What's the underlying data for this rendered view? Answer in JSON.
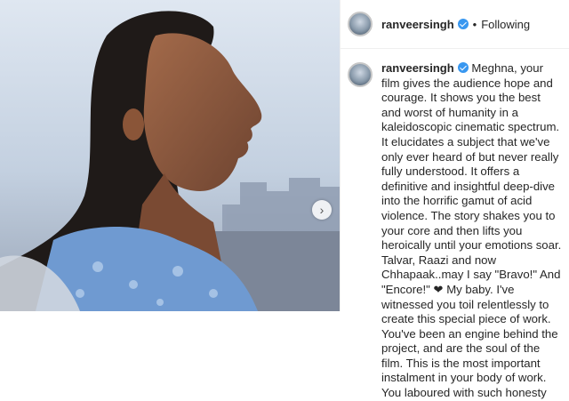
{
  "post": {
    "username": "ranveersingh",
    "follow_status": "Following",
    "separator": "•",
    "caption": "Meghna, your film gives the audience hope and courage. It shows you the best and worst of humanity in a kaleidoscopic cinematic spectrum. It elucidates a subject that we've only ever heard of but never really fully understood. It offers a definitive and insightful deep-dive into the horrific gamut of acid violence. The story shakes you to your core and then lifts you heroically until your emotions soar. Talvar, Raazi and now Chhapaak..may I say \"Bravo!\" And \"Encore!\" ❤ My baby. I've witnessed you toil relentlessly to create this special piece of work. You've been an engine behind the project, and are the soul of the film. This is the most important instalment in your body of work. You laboured with such honesty"
  },
  "icons": {
    "verified": "verified-badge-icon",
    "next": "chevron-right-icon"
  },
  "colors": {
    "verified_blue": "#3897f0",
    "text": "#262626",
    "border": "#efefef"
  }
}
